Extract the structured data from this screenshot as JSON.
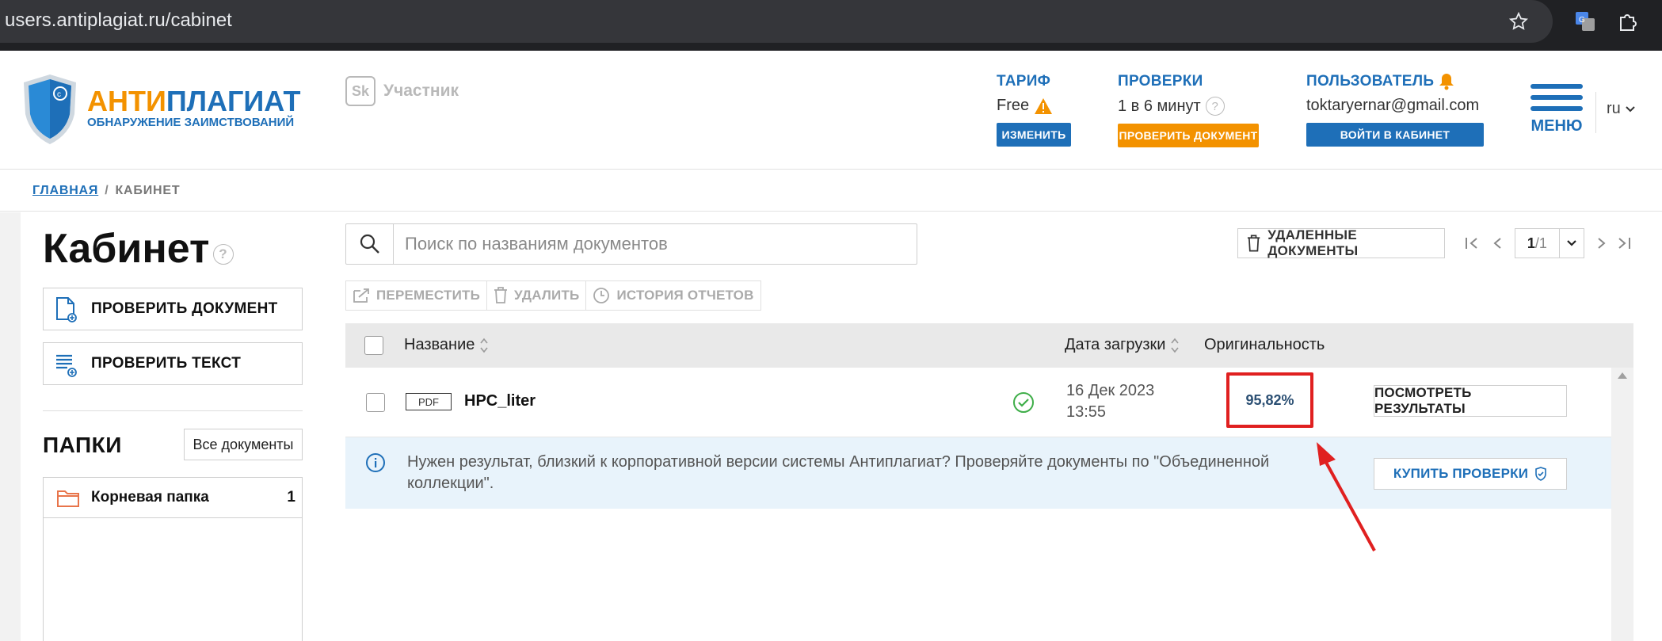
{
  "browser": {
    "url": "users.antiplagiat.ru/cabinet"
  },
  "logo": {
    "title_part1": "АНТИ",
    "title_part2": "ПЛАГИАТ",
    "subtitle": "ОБНАРУЖЕНИЕ ЗАИМСТВОВАНИЙ"
  },
  "participant": {
    "badge": "Sk",
    "label": "Участник"
  },
  "header": {
    "tariff": {
      "label": "ТАРИФ",
      "value": "Free",
      "button": "ИЗМЕНИТЬ"
    },
    "checks": {
      "label": "ПРОВЕРКИ",
      "value": "1 в 6 минут",
      "button": "ПРОВЕРИТЬ ДОКУМЕНТ"
    },
    "user": {
      "label": "ПОЛЬЗОВАТЕЛЬ",
      "email": "toktaryernar@gmail.com",
      "button": "ВОЙТИ В КАБИНЕТ"
    },
    "menu_label": "МЕНЮ",
    "lang": "ru"
  },
  "breadcrumb": {
    "home": "ГЛАВНАЯ",
    "separator": "/",
    "current": "КАБИНЕТ"
  },
  "sidebar": {
    "title": "Кабинет",
    "help": "?",
    "check_document": "ПРОВЕРИТЬ ДОКУМЕНТ",
    "check_text": "ПРОВЕРИТЬ ТЕКСТ",
    "folders_title": "ПАПКИ",
    "all_documents": "Все документы",
    "folders": [
      {
        "name": "Корневая папка",
        "count": "1"
      }
    ]
  },
  "main": {
    "search_placeholder": "Поиск по названиям документов",
    "deleted_docs": "УДАЛЕННЫЕ ДОКУМЕНТЫ",
    "pager": {
      "current": "1",
      "total": "/1"
    },
    "toolbar": {
      "move": "ПЕРЕМЕСТИТЬ",
      "delete": "УДАЛИТЬ",
      "history": "ИСТОРИЯ ОТЧЕТОВ"
    },
    "columns": {
      "name": "Название",
      "date": "Дата загрузки",
      "originality": "Оригинальность"
    },
    "rows": [
      {
        "type": "PDF",
        "name": "HPC_liter",
        "date": "16 Дек 2023",
        "time": "13:55",
        "originality": "95,82%",
        "action": "ПОСМОТРЕТЬ РЕЗУЛЬТАТЫ"
      }
    ],
    "info": {
      "text": "Нужен результат, близкий к корпоративной версии системы Антиплагиат? Проверяйте документы по \"Объединенной коллекции\".",
      "button": "КУПИТЬ ПРОВЕРКИ"
    }
  },
  "colors": {
    "brand_blue": "#1e6fb8",
    "brand_orange": "#f39200",
    "highlight_red": "#e02020"
  }
}
